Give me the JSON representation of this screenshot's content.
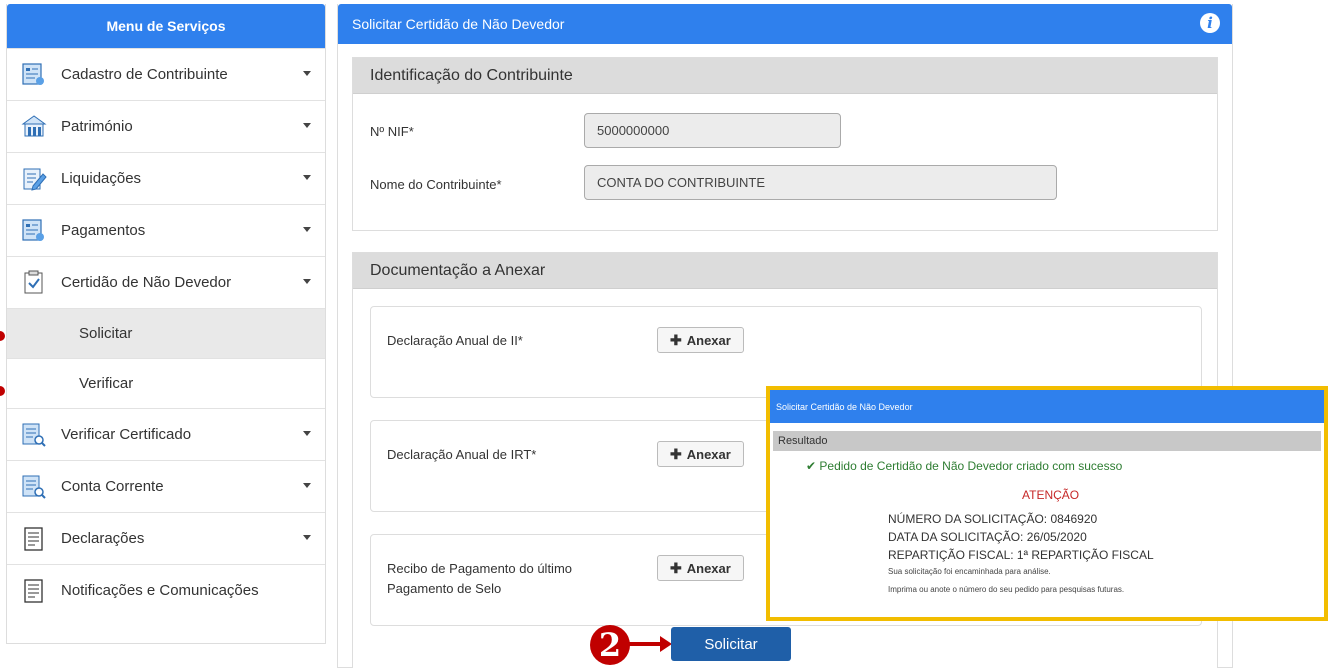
{
  "sidebar": {
    "title": "Menu de Serviços",
    "items": [
      {
        "label": "Cadastro de Contribuinte",
        "icon": "form-icon"
      },
      {
        "label": "Património",
        "icon": "building-icon"
      },
      {
        "label": "Liquidações",
        "icon": "edit-document-icon"
      },
      {
        "label": "Pagamentos",
        "icon": "payment-form-icon"
      },
      {
        "label": "Certidão de Não Devedor",
        "icon": "certificate-check-icon"
      }
    ],
    "subitems": [
      {
        "label": "Solicitar"
      },
      {
        "label": "Verificar"
      }
    ],
    "items_after": [
      {
        "label": "Verificar Certificado",
        "icon": "certificate-search-icon"
      },
      {
        "label": "Conta Corrente",
        "icon": "account-ledger-icon"
      },
      {
        "label": "Declarações",
        "icon": "declaration-icon"
      },
      {
        "label": "Notificações e Comunicações",
        "icon": "notification-document-icon"
      }
    ]
  },
  "main": {
    "title": "Solicitar Certidão de Não Devedor",
    "identificacao": {
      "title": "Identificação do Contribuinte",
      "nif_label": "Nº NIF*",
      "nif_value": "5000000000",
      "nome_label": "Nome do Contribuinte*",
      "nome_value": "CONTA DO CONTRIBUINTE"
    },
    "documentacao": {
      "title": "Documentação a Anexar",
      "attach_label": "Anexar",
      "docs": [
        {
          "label": "Declaração Anual de II*"
        },
        {
          "label": "Declaração Anual de IRT*"
        },
        {
          "label": "Recibo de Pagamento do último Pagamento de Selo"
        }
      ]
    }
  },
  "popup": {
    "title": "Solicitar Certidão de Não Devedor",
    "section": "Resultado",
    "success": "Pedido de Certidão de Não Devedor criado com sucesso",
    "attention": "ATENÇÃO",
    "numero": "NÚMERO DA SOLICITAÇÃO: 0846920",
    "data": "DATA DA SOLICITAÇÃO: 26/05/2020",
    "reparticao": "REPARTIÇÃO FISCAL: 1ª REPARTIÇÃO FISCAL",
    "note1": "Sua solicitação foi encaminhada para análise.",
    "note2": "Imprima ou anote o número do seu pedido para pesquisas futuras."
  },
  "footer": {
    "step_number": "2",
    "submit_label": "Solicitar"
  },
  "colors": {
    "header_blue": "#2f80ed",
    "button_blue": "#1f5fa8",
    "highlight_red": "#c00000",
    "popup_border": "#f2bd00",
    "success_green": "#2e7d32"
  }
}
